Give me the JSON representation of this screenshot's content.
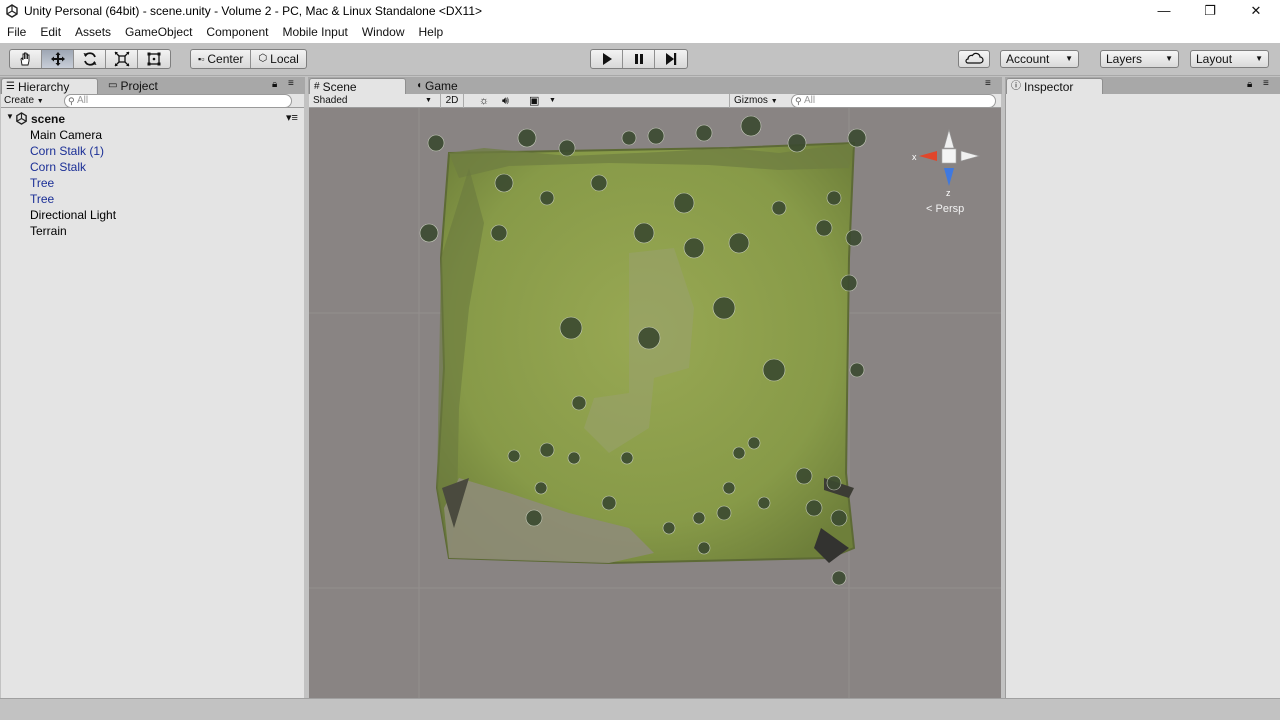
{
  "window": {
    "title": "Unity Personal (64bit) - scene.unity - Volume 2 - PC, Mac & Linux Standalone <DX11>",
    "minimize": "—",
    "restore": "❐",
    "close": "✕"
  },
  "menu": [
    "File",
    "Edit",
    "Assets",
    "GameObject",
    "Component",
    "Mobile Input",
    "Window",
    "Help"
  ],
  "toolbar": {
    "tools": [
      "hand-tool-icon",
      "move-tool-icon",
      "rotate-tool-icon",
      "scale-tool-icon",
      "rect-tool-icon"
    ],
    "active_tool": "move-tool-icon",
    "pivot": "Center",
    "space": "Local",
    "account": "Account",
    "layers": "Layers",
    "layout": "Layout"
  },
  "hierarchy": {
    "tab": "Hierarchy",
    "other_tab": "Project",
    "create": "Create",
    "search_placeholder": "All",
    "scene_name": "scene",
    "items": [
      {
        "label": "Main Camera",
        "prefab": false
      },
      {
        "label": "Corn Stalk (1)",
        "prefab": true
      },
      {
        "label": "Corn Stalk",
        "prefab": true
      },
      {
        "label": "Tree",
        "prefab": true
      },
      {
        "label": "Tree",
        "prefab": true
      },
      {
        "label": "Directional Light",
        "prefab": false
      },
      {
        "label": "Terrain",
        "prefab": false
      }
    ]
  },
  "scene": {
    "tab": "Scene",
    "other_tab": "Game",
    "shading": "Shaded",
    "mode_2d": "2D",
    "gizmos": "Gizmos",
    "search_placeholder": "All",
    "gizmo_x": "x",
    "gizmo_z": "z",
    "projection": "Persp"
  },
  "inspector": {
    "tab": "Inspector"
  },
  "colors": {
    "editor_bg": "#c2c2c2",
    "panel_bg": "#e4e4e4",
    "scene_bg": "#898483",
    "prefab_text": "#1b2f96",
    "terrain_grass": "#8f9f4d",
    "axis_x": "#e0462b",
    "axis_z": "#3f79e0"
  }
}
